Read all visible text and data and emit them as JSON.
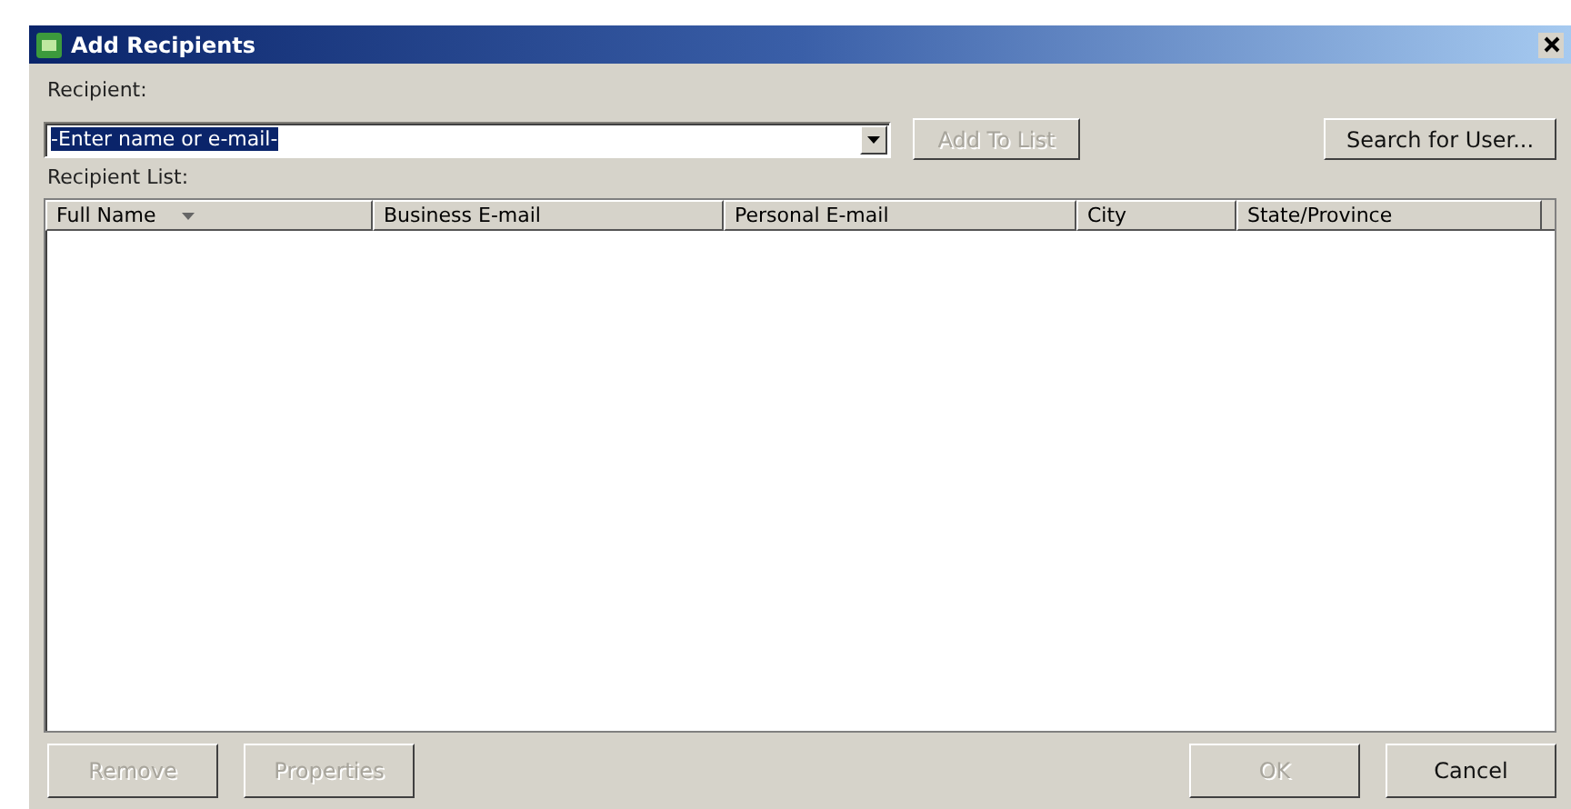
{
  "window": {
    "title": "Add Recipients"
  },
  "recipient": {
    "label": "Recipient:",
    "value": "-Enter name or e-mail-",
    "text_selected": true
  },
  "add_button": {
    "label": "Add To List",
    "disabled": true
  },
  "search_button": {
    "label": "Search for User...",
    "disabled": false
  },
  "list": {
    "label": "Recipient List:",
    "columns": [
      {
        "label": "Full Name",
        "sorted": true
      },
      {
        "label": "Business E-mail",
        "sorted": false
      },
      {
        "label": "Personal E-mail",
        "sorted": false
      },
      {
        "label": "City",
        "sorted": false
      },
      {
        "label": "State/Province",
        "sorted": false
      }
    ]
  },
  "buttons": [
    {
      "label": "Remove",
      "disabled": true,
      "kind": "left"
    },
    {
      "label": "Properties",
      "disabled": true,
      "kind": "left"
    },
    {
      "label": "OK",
      "disabled": true,
      "kind": "right"
    },
    {
      "label": "Cancel",
      "disabled": false,
      "kind": "right"
    }
  ]
}
